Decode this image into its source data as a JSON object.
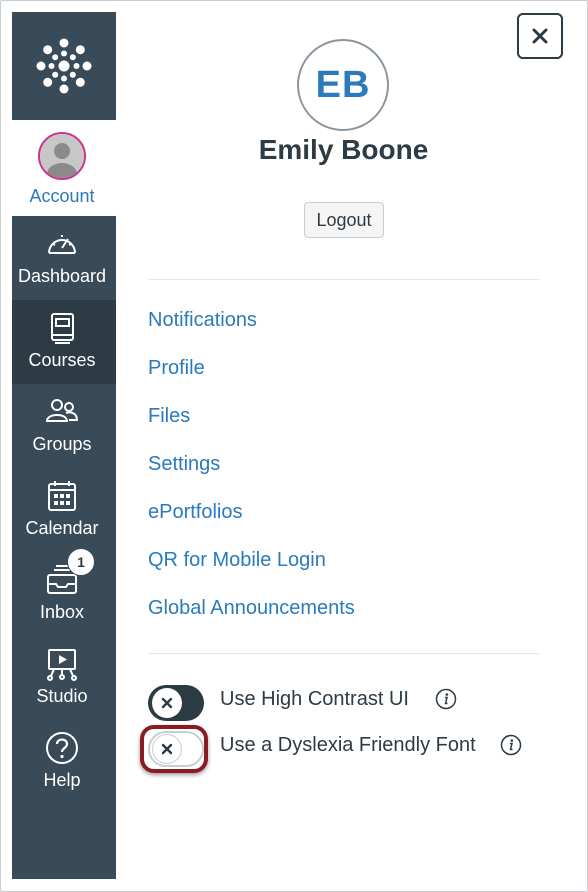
{
  "global_nav": {
    "logo_icon": "canvas-logo-icon",
    "account": {
      "label": "Account",
      "icon": "avatar-placeholder-icon"
    },
    "items": [
      {
        "label": "Dashboard",
        "icon": "dashboard-speedometer-icon"
      },
      {
        "label": "Courses",
        "icon": "courses-book-icon"
      },
      {
        "label": "Groups",
        "icon": "groups-people-icon"
      },
      {
        "label": "Calendar",
        "icon": "calendar-icon"
      },
      {
        "label": "Inbox",
        "icon": "inbox-icon",
        "badge": "1"
      },
      {
        "label": "Studio",
        "icon": "studio-screen-icon"
      },
      {
        "label": "Help",
        "icon": "help-question-icon"
      }
    ]
  },
  "tray": {
    "close_icon": "close-icon",
    "avatar_initials": "EB",
    "user_name": "Emily Boone",
    "logout_label": "Logout",
    "links": [
      "Notifications",
      "Profile",
      "Files",
      "Settings",
      "ePortfolios",
      "QR for Mobile Login",
      "Global Announcements"
    ],
    "toggles": [
      {
        "label": "Use High Contrast UI",
        "state": "off",
        "info_icon": "info-icon"
      },
      {
        "label": "Use a Dyslexia Friendly Font",
        "state": "off",
        "info_icon": "info-icon"
      }
    ]
  },
  "colors": {
    "nav_bg": "#394b58",
    "nav_active_bg": "#2d3b45",
    "link_blue": "#2b7abc",
    "text_dark": "#2d3b45",
    "highlight_red": "#8b1a23",
    "account_ring": "#c9358f"
  }
}
